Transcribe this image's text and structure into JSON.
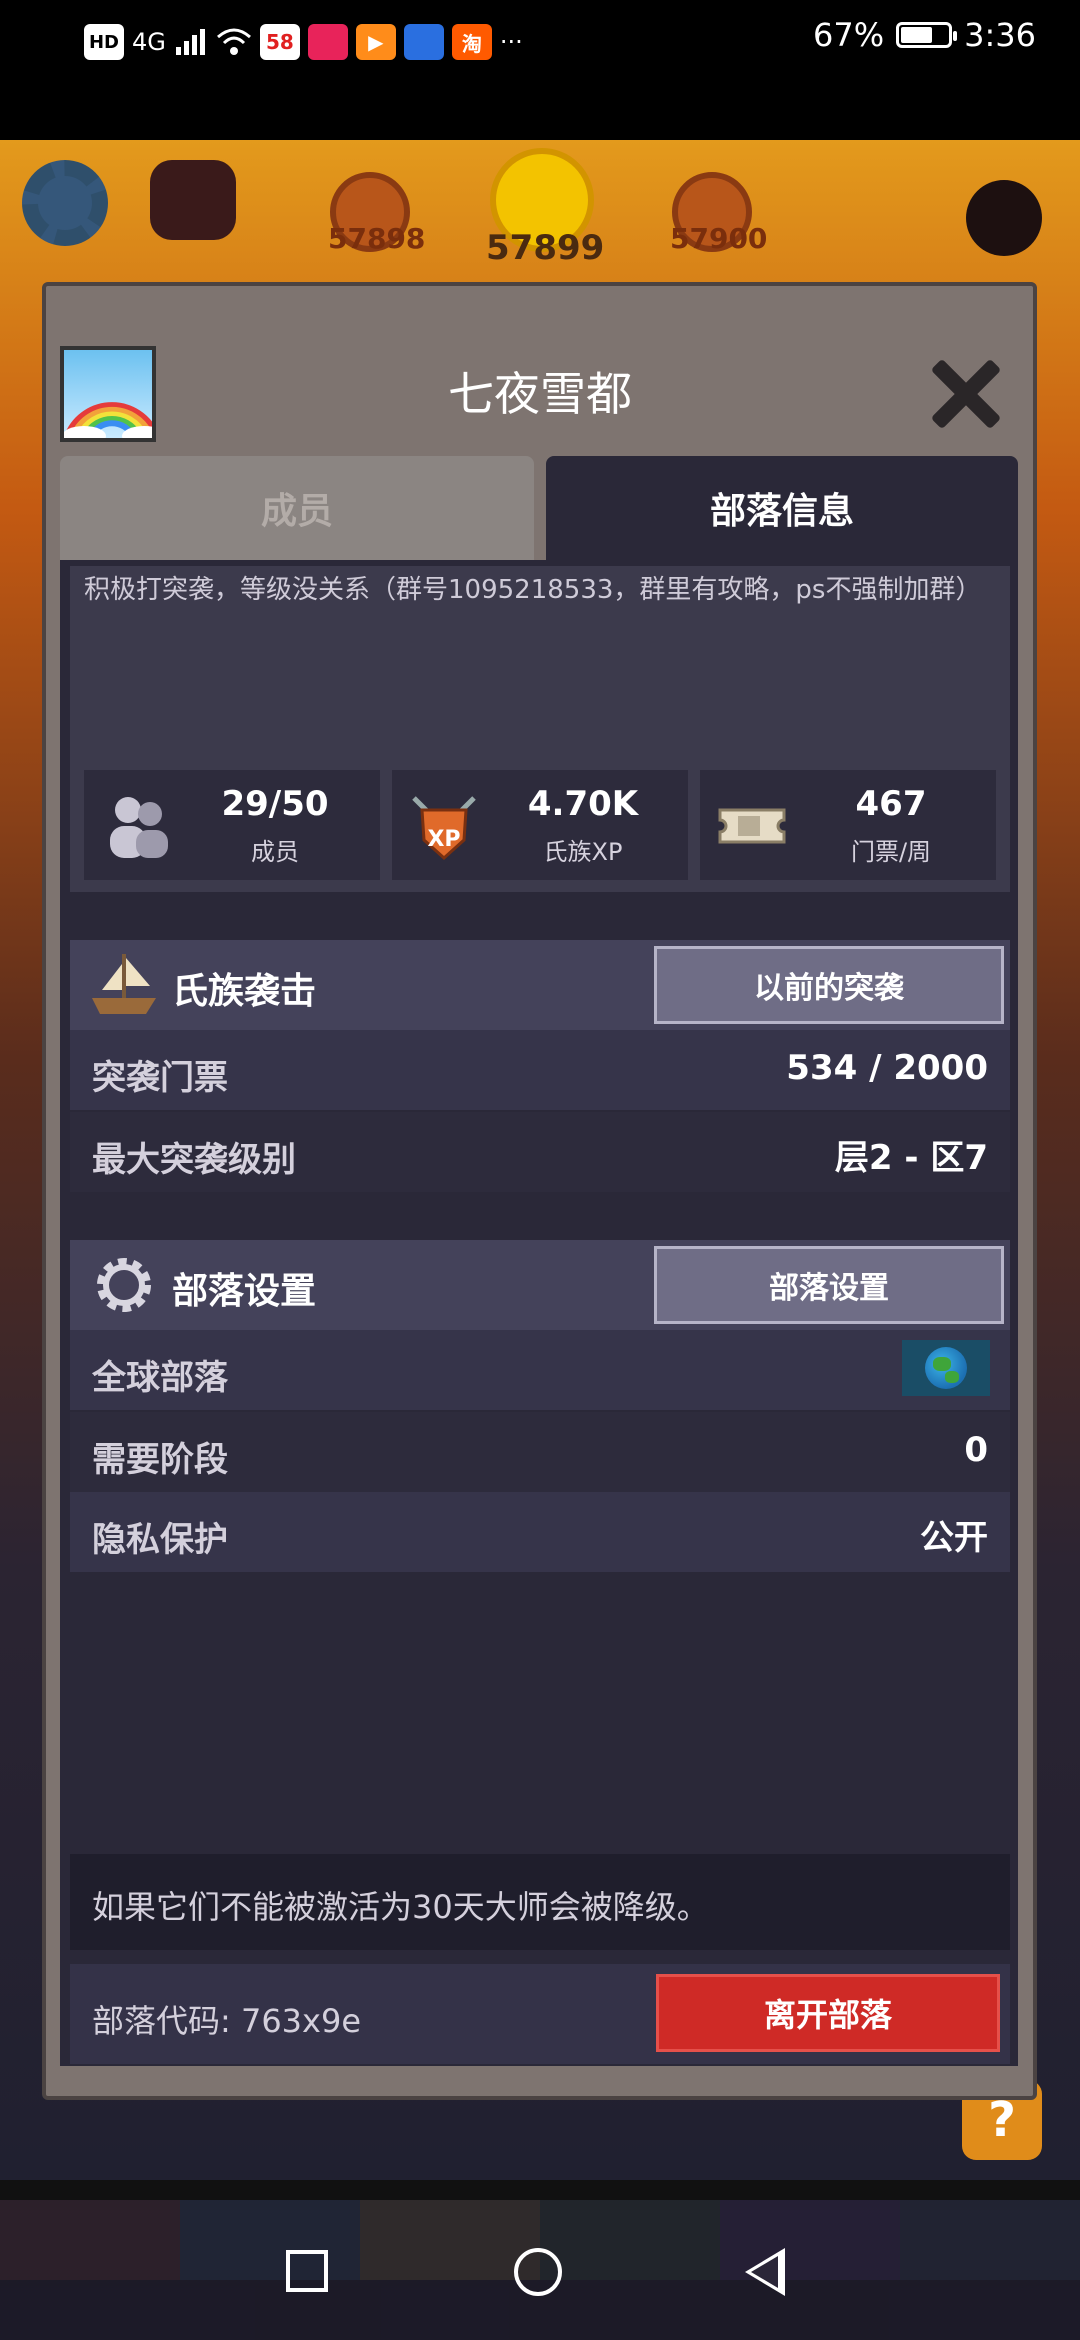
{
  "status_bar": {
    "left_icons": [
      "hd-icon",
      "4g-signal-icon",
      "wifi-icon",
      "58-app-icon",
      "tmall-app-icon",
      "video-app-icon",
      "browser-app-icon",
      "taobao-app-icon"
    ],
    "hd": "HD",
    "net": "4G",
    "app1": "58",
    "app5": "淘",
    "more": "···",
    "battery": "67%",
    "battery_level": 0.67,
    "time": "3:36"
  },
  "game_bg": {
    "coin_left": "57898",
    "coin_center": "57899",
    "coin_right": "57900",
    "help": "?"
  },
  "modal": {
    "title": "七夜雪都",
    "tabs": {
      "members": "成员",
      "info": "部落信息"
    },
    "description": "积极打突袭，等级没关系（群号1095218533，群里有攻略，ps不强制加群）",
    "stats": [
      {
        "value": "29/50",
        "label": "成员"
      },
      {
        "value": "4.70K",
        "label": "氏族XP"
      },
      {
        "value": "467",
        "label": "门票/周"
      }
    ],
    "xp_icon_text": "XP",
    "raid": {
      "title": "氏族袭击",
      "button": "以前的突袭",
      "rows": [
        {
          "label": "突袭门票",
          "value": "534 / 2000"
        },
        {
          "label": "最大突袭级别",
          "value": "层2 - 区7"
        }
      ]
    },
    "settings": {
      "title": "部落设置",
      "button": "部落设置",
      "global_label": "全球部落",
      "rows": [
        {
          "label": "需要阶段",
          "value": "0"
        },
        {
          "label": "隐私保护",
          "value": "公开"
        }
      ]
    },
    "notice": "如果它们不能被激活为30天大师会被降级。",
    "clan_code": "部落代码: 763x9e",
    "leave_button": "离开部落"
  }
}
